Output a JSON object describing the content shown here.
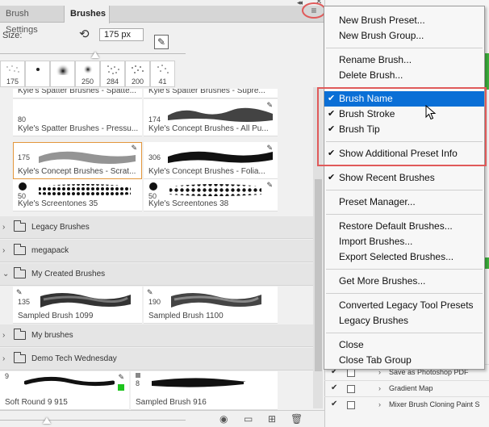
{
  "tabs": {
    "brush_settings": "Brush Settings",
    "brushes": "Brushes"
  },
  "size": {
    "label": "Size:",
    "value": "175 px"
  },
  "recent_brushes": [
    "175",
    "",
    "",
    "250",
    "284",
    "200",
    "41"
  ],
  "brush_cells": [
    {
      "name": "Kyle's Spatter Brushes - Spatte...",
      "num": ""
    },
    {
      "name": "Kyle's Spatter Brushes - Supre...",
      "num": ""
    },
    {
      "name": "Kyle's Spatter Brushes - Pressu...",
      "num": "80"
    },
    {
      "name": "Kyle's Concept Brushes - All Pu...",
      "num": "174"
    },
    {
      "name": "Kyle's Concept Brushes - Scrat...",
      "num": "175"
    },
    {
      "name": "Kyle's Concept Brushes - Folia...",
      "num": "306"
    },
    {
      "name": "Kyle's Screentones 35",
      "num": "50"
    },
    {
      "name": "Kyle's Screentones 38",
      "num": "50"
    },
    {
      "name": "Sampled Brush 1099",
      "num": "135"
    },
    {
      "name": "Sampled Brush 1100",
      "num": "190"
    },
    {
      "name": "Soft Round 9 915",
      "num": "9"
    },
    {
      "name": "Sampled Brush 916",
      "num": "8"
    }
  ],
  "folders": [
    "Legacy Brushes",
    "megapack",
    "My Created Brushes",
    "My brushes",
    "Demo Tech Wednesday"
  ],
  "menu": {
    "items": [
      {
        "label": "New Brush Preset...",
        "checked": false
      },
      {
        "label": "New Brush Group...",
        "checked": false
      },
      {
        "label": "Rename Brush...",
        "checked": false
      },
      {
        "label": "Delete Brush...",
        "checked": false
      },
      {
        "label": "Brush Name",
        "checked": true
      },
      {
        "label": "Brush Stroke",
        "checked": true
      },
      {
        "label": "Brush Tip",
        "checked": true
      },
      {
        "label": "Show Additional Preset Info",
        "checked": true
      },
      {
        "label": "Show Recent Brushes",
        "checked": true
      },
      {
        "label": "Preset Manager...",
        "checked": false
      },
      {
        "label": "Restore Default Brushes...",
        "checked": false
      },
      {
        "label": "Import Brushes...",
        "checked": false
      },
      {
        "label": "Export Selected Brushes...",
        "checked": false
      },
      {
        "label": "Get More Brushes...",
        "checked": false
      },
      {
        "label": "Converted Legacy Tool Presets",
        "checked": false
      },
      {
        "label": "Legacy Brushes",
        "checked": false
      },
      {
        "label": "Close",
        "checked": false
      },
      {
        "label": "Close Tab Group",
        "checked": false
      }
    ],
    "highlighted": "Brush Name"
  },
  "actions": [
    {
      "label": "Save as Photoshop PDF"
    },
    {
      "label": "Gradient Map"
    },
    {
      "label": "Mixer Brush Cloning Paint S"
    }
  ],
  "colors": {
    "accent": "#0a6fd6",
    "annotation": "#e05a5a",
    "selection_outline": "#e3963b",
    "green": "#3cb03c"
  },
  "icons": [
    "collapse-icon",
    "close-icon",
    "panel-menu-icon",
    "reset-size-icon",
    "edit-brush-icon",
    "folder-icon",
    "chevron-right-icon",
    "chevron-down-icon",
    "visibility-icon",
    "new-group-icon",
    "new-brush-icon",
    "trash-icon",
    "mouse-cursor-icon"
  ]
}
